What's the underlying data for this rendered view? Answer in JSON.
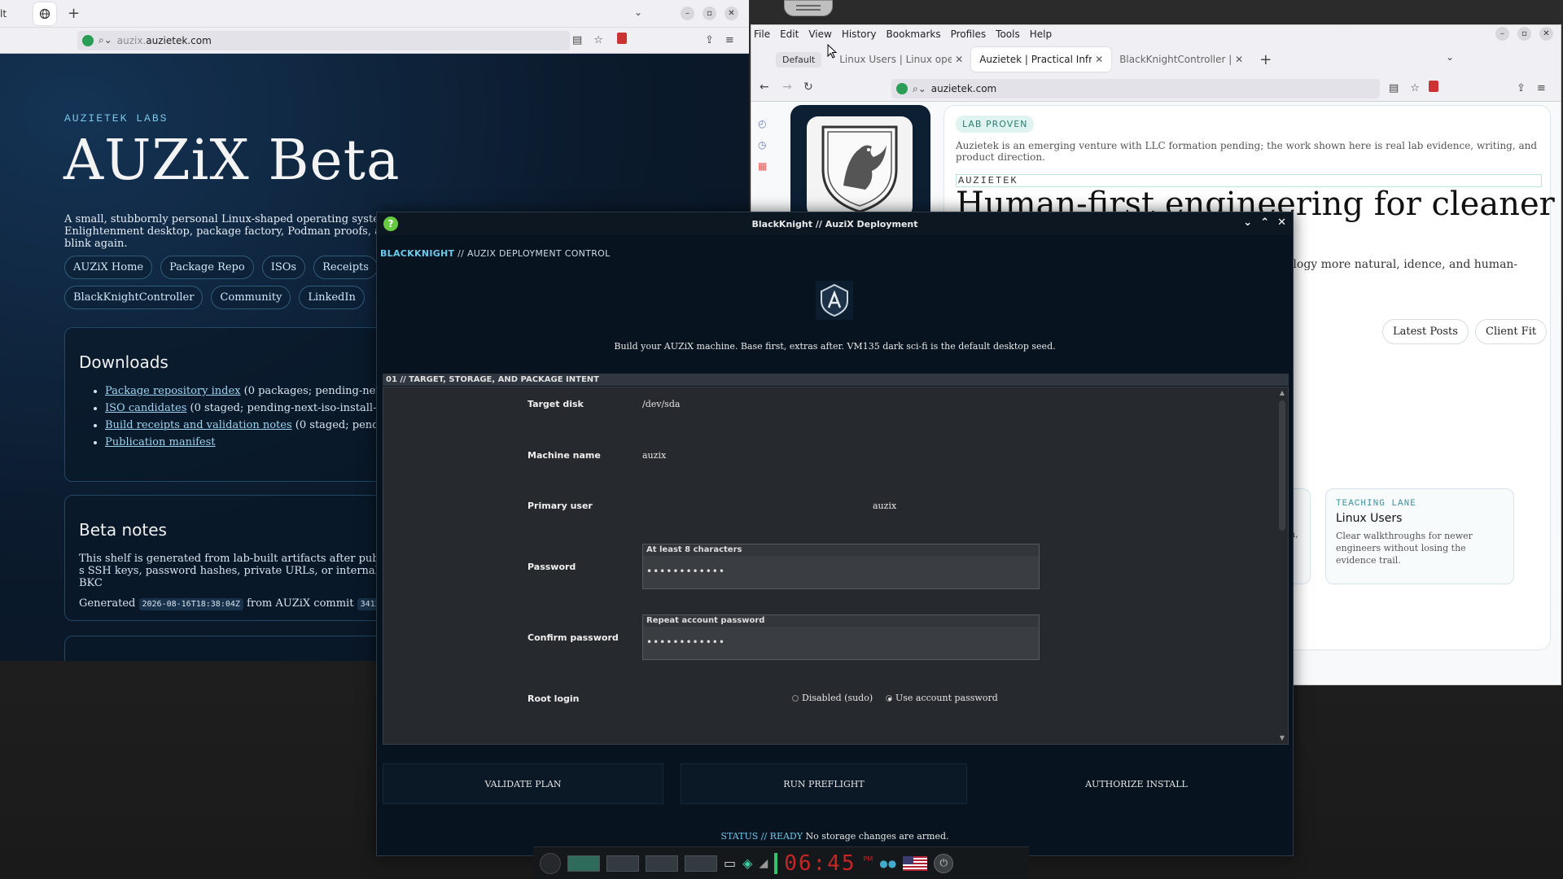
{
  "left_browser": {
    "tab_stub": "lt",
    "url_dim": "auzix.",
    "url_host": "auzietek.com",
    "page": {
      "eyebrow": "AUZIETEK LABS",
      "title": "AUZiX Beta",
      "description": "A small, stubbornly personal Linux-shaped operating system experiment: strict AUZiX paths, Enlightenment desktop, package factory, Podman proofs, and tiny containers that keep making people blink again.",
      "pills_row1": [
        "AUZiX Home",
        "Package Repo",
        "ISOs",
        "Receipts"
      ],
      "pills_row2": [
        "BlackKnightController",
        "Community",
        "LinkedIn"
      ],
      "downloads": {
        "heading": "Downloads",
        "items": [
          {
            "link": "Package repository index",
            "rest": "(0 packages; pending-next-i"
          },
          {
            "link": "ISO candidates",
            "rest": "(0 staged; pending-next-iso-install-pro"
          },
          {
            "link": "Build receipts and validation notes",
            "rest": "(0 staged; pending"
          },
          {
            "link": "Publication manifest",
            "rest": ""
          }
        ]
      },
      "beta_notes": {
        "heading": "Beta notes",
        "body": "This shelf is generated from lab-built artifacts after public-s SSH keys, password hashes, private URLs, or internal BKC",
        "generated_label": "Generated",
        "generated_ts": "2026-08-16T18:38:04Z",
        "commit_label": "from AUZiX commit",
        "commit_hash": "341375e"
      }
    }
  },
  "right_browser": {
    "menu": [
      "File",
      "Edit",
      "View",
      "History",
      "Bookmarks",
      "Profiles",
      "Tools",
      "Help"
    ],
    "profile_chip": "Default",
    "tabs": [
      {
        "label": "Linux Users | Linux operation",
        "active": false
      },
      {
        "label": "Auzietek | Practical Infrastru",
        "active": true
      },
      {
        "label": "BlackKnightController | Rebu",
        "active": false
      }
    ],
    "url": "auzietek.com",
    "page": {
      "badge": "LAB PROVEN",
      "intro": "Auzietek is an emerging venture with LLC formation pending; the work shown here is real lab evidence, writing, and product direction.",
      "eyebrow": "AUZIETEK",
      "title": "Human-first engineering for cleaner",
      "body": "ology more natural, idence, and human-",
      "btn_latest": "Latest Posts",
      "btn_client": "Client Fit",
      "lane_partial": "ation, tor-",
      "lane_tag": "TEACHING LANE",
      "lane_title": "Linux Users",
      "lane_desc": "Clear walkthroughs for newer engineers without losing the evidence trail."
    }
  },
  "dialog": {
    "title": "BlackKnight // AuziX Deployment",
    "crumb_a": "BLACKKNIGHT",
    "crumb_sep": "//",
    "crumb_b": "AUZIX DEPLOYMENT CONTROL",
    "tagline": "Build your AUZiX machine. Base first, extras after. VM135 dark sci-fi is the default desktop seed.",
    "section": "01 // TARGET, STORAGE, AND PACKAGE INTENT",
    "fields": {
      "target_disk_label": "Target disk",
      "target_disk_value": "/dev/sda",
      "machine_name_label": "Machine name",
      "machine_name_value": "auzix",
      "primary_user_label": "Primary user",
      "primary_user_value": "auzix",
      "password_label": "Password",
      "password_hint": "At least 8 characters",
      "password_value": "••••••••••••",
      "confirm_label": "Confirm password",
      "confirm_hint": "Repeat account password",
      "confirm_value": "••••••••••••",
      "root_label": "Root login",
      "root_opt_disabled": "Disabled (sudo)",
      "root_opt_account": "Use account password"
    },
    "buttons": {
      "validate": "VALIDATE PLAN",
      "preflight": "RUN PREFLIGHT",
      "authorize": "AUTHORIZE INSTALL"
    },
    "status_label": "STATUS // READY",
    "status_text": "No storage changes are armed."
  },
  "dock": {
    "time": "06:45",
    "ampm": "PM"
  },
  "colors": {
    "accent_cyan": "#6cc9ea",
    "clock_red": "#c72525",
    "badge_green": "#2a7f73"
  }
}
